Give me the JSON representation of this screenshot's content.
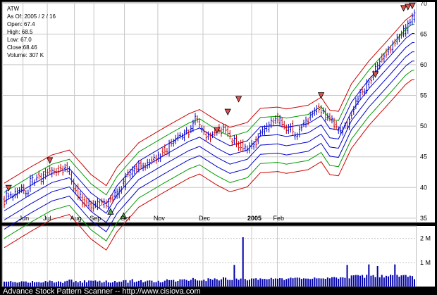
{
  "chart_data": {
    "type": "candlestick",
    "symbol": "ATW",
    "info": {
      "as_of": "As Of: 2005 / 2 / 16",
      "open": "Open: 67.4",
      "high": "High: 68.5",
      "low": "Low: 67.0",
      "close": "Close:68.46",
      "volume": "Volume: 307 K"
    },
    "x_labels": [
      "Jun",
      "Jul",
      "Aug",
      "Sep",
      "Oct",
      "Nov",
      "Dec",
      "2005",
      "Feb"
    ],
    "y_ticks": [
      35,
      40,
      45,
      50,
      55,
      60,
      65,
      70
    ],
    "ylim": [
      34.3,
      70.2
    ],
    "volume_ticks": [
      "2 M",
      "1 M"
    ],
    "volume_max": 2400,
    "colors": {
      "up": "#0000cc",
      "down": "#cc0000",
      "band_red": "#cc0000",
      "band_green": "#009900",
      "band_blue": "#0000cc",
      "grid": "#c8c8c8",
      "volume": "#0000aa",
      "marker_up": "#4caf50",
      "marker_down": "#e05050"
    },
    "band_offsets": [
      -7,
      -5.5,
      -4,
      -2.5,
      -1,
      0.5,
      2,
      3.5
    ],
    "band_colors": [
      "red",
      "green",
      "blue",
      "blue",
      "blue",
      "blue",
      "green",
      "red"
    ],
    "trend": [
      [
        0,
        37.2
      ],
      [
        12,
        39.8
      ],
      [
        22,
        41.8
      ],
      [
        30,
        42.6
      ],
      [
        40,
        38.6
      ],
      [
        47,
        36.8
      ],
      [
        52,
        39.8
      ],
      [
        62,
        43.8
      ],
      [
        74,
        46.3
      ],
      [
        85,
        48.5
      ],
      [
        90,
        49.2
      ],
      [
        98,
        47.4
      ],
      [
        104,
        46.3
      ],
      [
        112,
        47.1
      ],
      [
        118,
        49.4
      ],
      [
        126,
        49.6
      ],
      [
        130,
        49.3
      ],
      [
        140,
        49.9
      ],
      [
        146,
        51.2
      ],
      [
        150,
        49.1
      ],
      [
        154,
        48.9
      ],
      [
        160,
        53.4
      ],
      [
        168,
        57.1
      ],
      [
        178,
        61.0
      ],
      [
        185,
        63.8
      ],
      [
        188,
        64.6
      ]
    ],
    "candles": [
      [
        38.1,
        37.2
      ],
      [
        37.8,
        39.1
      ],
      [
        38.6,
        38.6
      ],
      [
        38.8,
        38.8
      ],
      [
        38.4,
        38.5
      ],
      [
        38.8,
        39.4
      ],
      [
        38.8,
        39.4
      ],
      [
        39.5,
        39.5
      ],
      [
        39.7,
        40.0
      ],
      [
        40.0,
        39.5
      ],
      [
        39.0,
        39.0
      ],
      [
        39.0,
        39.1
      ],
      [
        39.8,
        41.5
      ],
      [
        40.9,
        41.6
      ],
      [
        40.8,
        40.8
      ],
      [
        41.4,
        41.6
      ],
      [
        42.2,
        41.9
      ],
      [
        41.8,
        41.0
      ],
      [
        41.0,
        42.1
      ],
      [
        42.6,
        41.9
      ],
      [
        42.5,
        42.4
      ],
      [
        43.1,
        42.7
      ],
      [
        42.2,
        42.8
      ],
      [
        42.7,
        42.6
      ],
      [
        42.6,
        42.4
      ],
      [
        43.1,
        42.5
      ],
      [
        43.3,
        43.1
      ],
      [
        43.0,
        42.5
      ],
      [
        43.1,
        43.3
      ],
      [
        43.6,
        43.0
      ],
      [
        42.6,
        42.9
      ],
      [
        42.1,
        41.0
      ],
      [
        40.9,
        39.8
      ],
      [
        39.8,
        39.5
      ],
      [
        40.1,
        38.5
      ],
      [
        38.4,
        38.9
      ],
      [
        38.4,
        37.3
      ],
      [
        38.0,
        37.3
      ],
      [
        37.8,
        37.5
      ],
      [
        37.1,
        37.7
      ],
      [
        37.3,
        36.7
      ],
      [
        37.4,
        36.6
      ],
      [
        37.2,
        37.3
      ],
      [
        36.9,
        37.7
      ],
      [
        37.6,
        37.1
      ],
      [
        37.7,
        37.6
      ],
      [
        37.2,
        37.7
      ],
      [
        37.5,
        37.1
      ],
      [
        36.9,
        37.7
      ],
      [
        38.2,
        38.1
      ],
      [
        38.3,
        38.0
      ],
      [
        38.6,
        39.2
      ],
      [
        38.7,
        39.3
      ],
      [
        38.8,
        39.6
      ],
      [
        39.5,
        39.7
      ],
      [
        40.7,
        41.0
      ],
      [
        40.1,
        41.8
      ],
      [
        42.4,
        42.2
      ],
      [
        42.0,
        42.5
      ],
      [
        42.2,
        42.9
      ],
      [
        42.7,
        43.1
      ],
      [
        43.4,
        43.0
      ],
      [
        43.0,
        43.9
      ],
      [
        44.0,
        43.5
      ],
      [
        43.2,
        43.5
      ],
      [
        43.5,
        43.3
      ],
      [
        43.6,
        44.1
      ],
      [
        43.7,
        44.1
      ],
      [
        44.5,
        44.3
      ],
      [
        44.6,
        44.9
      ],
      [
        44.8,
        44.4
      ],
      [
        44.7,
        45.3
      ],
      [
        44.7,
        45.0
      ],
      [
        45.9,
        45.7
      ],
      [
        46.5,
        45.9
      ],
      [
        45.9,
        45.8
      ],
      [
        45.6,
        47.2
      ],
      [
        47.4,
        47.2
      ],
      [
        47.2,
        47.4
      ],
      [
        47.6,
        48.0
      ],
      [
        48.1,
        48.4
      ],
      [
        48.5,
        48.5
      ],
      [
        48.3,
        48.3
      ],
      [
        48.1,
        48.9
      ],
      [
        49.2,
        49.3
      ],
      [
        48.9,
        48.6
      ],
      [
        49.4,
        49.6
      ],
      [
        49.6,
        50.5
      ],
      [
        50.7,
        51.6
      ],
      [
        51.2,
        51.1
      ],
      [
        50.7,
        50.3
      ],
      [
        49.5,
        49.6
      ],
      [
        49.5,
        49.1
      ],
      [
        48.6,
        48.1
      ],
      [
        48.3,
        48.6
      ],
      [
        48.4,
        47.9
      ],
      [
        48.6,
        48.6
      ],
      [
        49.0,
        48.9
      ],
      [
        49.0,
        49.2
      ],
      [
        49.8,
        49.3
      ],
      [
        49.3,
        48.8
      ],
      [
        49.5,
        49.8
      ],
      [
        49.8,
        49.3
      ],
      [
        49.5,
        48.8
      ],
      [
        48.8,
        48.4
      ],
      [
        47.5,
        47.3
      ],
      [
        47.6,
        48.0
      ],
      [
        48.0,
        47.1
      ],
      [
        47.0,
        46.5
      ],
      [
        47.2,
        46.5
      ],
      [
        47.3,
        46.3
      ],
      [
        46.4,
        46.6
      ],
      [
        46.1,
        46.3
      ],
      [
        46.1,
        46.8
      ],
      [
        46.8,
        47.2
      ],
      [
        46.7,
        47.0
      ],
      [
        47.8,
        47.0
      ],
      [
        47.6,
        48.3
      ],
      [
        48.8,
        48.9
      ],
      [
        49.1,
        49.4
      ],
      [
        49.1,
        49.6
      ],
      [
        49.6,
        50.0
      ],
      [
        49.5,
        50.2
      ],
      [
        50.2,
        50.9
      ],
      [
        50.8,
        50.6
      ],
      [
        50.9,
        51.2
      ],
      [
        51.6,
        51.0
      ],
      [
        50.5,
        51.3
      ],
      [
        50.9,
        50.3
      ],
      [
        50.3,
        50.0
      ],
      [
        49.7,
        49.3
      ],
      [
        49.3,
        49.8
      ],
      [
        49.5,
        49.9
      ],
      [
        50.4,
        49.1
      ],
      [
        48.3,
        48.5
      ],
      [
        48.3,
        48.4
      ],
      [
        48.7,
        49.5
      ],
      [
        49.7,
        49.8
      ],
      [
        50.4,
        50.5
      ],
      [
        50.3,
        51.0
      ],
      [
        50.8,
        50.7
      ],
      [
        51.4,
        51.8
      ],
      [
        51.9,
        52.0
      ],
      [
        52.2,
        52.5
      ],
      [
        52.4,
        52.9
      ],
      [
        53.2,
        52.7
      ],
      [
        52.9,
        52.2
      ],
      [
        52.5,
        52.5
      ],
      [
        52.4,
        51.1
      ],
      [
        51.4,
        51.6
      ],
      [
        51.6,
        51.3
      ],
      [
        51.0,
        51.2
      ],
      [
        50.8,
        49.9
      ],
      [
        50.3,
        49.9
      ],
      [
        49.3,
        49.4
      ],
      [
        49.2,
        49.3
      ],
      [
        49.0,
        49.4
      ],
      [
        50.1,
        50.1
      ],
      [
        50.5,
        50.0
      ],
      [
        49.9,
        51.1
      ],
      [
        51.8,
        51.7
      ],
      [
        52.4,
        52.7
      ],
      [
        53.3,
        54.1
      ],
      [
        54.0,
        54.4
      ],
      [
        54.9,
        55.5
      ],
      [
        55.9,
        55.6
      ],
      [
        55.5,
        55.6
      ],
      [
        55.8,
        57.1
      ],
      [
        56.8,
        57.2
      ],
      [
        57.6,
        57.4
      ],
      [
        58.0,
        58.5
      ],
      [
        58.6,
        59.7
      ],
      [
        59.1,
        59.9
      ],
      [
        59.8,
        60.5
      ],
      [
        61.3,
        60.9
      ],
      [
        61.0,
        61.4
      ],
      [
        62.1,
        61.6
      ],
      [
        62.1,
        62.5
      ],
      [
        62.6,
        62.4
      ],
      [
        62.5,
        63.4
      ],
      [
        63.7,
        63.5
      ],
      [
        63.8,
        64.5
      ],
      [
        64.2,
        64.5
      ],
      [
        65.0,
        64.8
      ],
      [
        65.0,
        65.9
      ],
      [
        65.1,
        66.1
      ],
      [
        65.6,
        66.7
      ],
      [
        66.9,
        66.9
      ],
      [
        67.0,
        67.9
      ],
      [
        67.4,
        68.46
      ]
    ],
    "volume": [
      205,
      202,
      205,
      231,
      184,
      185,
      161,
      179,
      221,
      212,
      212,
      163,
      162,
      231,
      179,
      184,
      188,
      163,
      176,
      234,
      189,
      249,
      230,
      164,
      182,
      219,
      194,
      152,
      216,
      240,
      287,
      287,
      178,
      235,
      174,
      231,
      162,
      258,
      175,
      251,
      247,
      241,
      255,
      207,
      242,
      164,
      190,
      251,
      174,
      160,
      178,
      234,
      173,
      205,
      201,
      260,
      269,
      158,
      256,
      309,
      181,
      206,
      239,
      265,
      173,
      211,
      246,
      257,
      245,
      175,
      184,
      242,
      172,
      184,
      244,
      300,
      267,
      269,
      278,
      204,
      234,
      300,
      295,
      306,
      273,
      237,
      278,
      357,
      309,
      252,
      251,
      248,
      283,
      229,
      345,
      320,
      280,
      340,
      305,
      253,
      302,
      384,
      369,
      280,
      276,
      269,
      225,
      333,
      279,
      333,
      266,
      316,
      256,
      285,
      336,
      331,
      345,
      278,
      340,
      312,
      320,
      301,
      314,
      360,
      316,
      338,
      326,
      351,
      342,
      269,
      314,
      338,
      371,
      346,
      366,
      372,
      365,
      318,
      343,
      332,
      330,
      311,
      325,
      378,
      340,
      344,
      337,
      339,
      321,
      378,
      343,
      387,
      396,
      375,
      327,
      387,
      382,
      362,
      417,
      339,
      461,
      468,
      481,
      477,
      451,
      482,
      361,
      487,
      364,
      450,
      478,
      393,
      473,
      383,
      486,
      375,
      445,
      424,
      495,
      473,
      402,
      487,
      411,
      466,
      478,
      482,
      406,
      452,
      435,
      307
    ],
    "volume_spikes": [
      [
        106,
        900
      ],
      [
        110,
        2050
      ],
      [
        158,
        900
      ],
      [
        168,
        920
      ],
      [
        172,
        850
      ],
      [
        180,
        920
      ]
    ],
    "markers": [
      {
        "type": "down",
        "i": 2,
        "price": 39.9
      },
      {
        "type": "down",
        "i": 21,
        "price": 44.4
      },
      {
        "type": "up",
        "i": 49,
        "price": 36.1
      },
      {
        "type": "up",
        "i": 55,
        "price": 35.4
      },
      {
        "type": "down",
        "i": 98,
        "price": 49.3
      },
      {
        "type": "down",
        "i": 103,
        "price": 52.3
      },
      {
        "type": "down",
        "i": 108,
        "price": 54.4
      },
      {
        "type": "down",
        "i": 146,
        "price": 55.0
      },
      {
        "type": "down",
        "i": 171,
        "price": 58.4
      },
      {
        "type": "down",
        "i": 184,
        "price": 69.2
      },
      {
        "type": "down",
        "i": 186,
        "price": 69.4
      },
      {
        "type": "down",
        "i": 188,
        "price": 69.6
      }
    ]
  },
  "footer": "Advance Stock Pattern Scanner -- http://www.cisiova.com"
}
